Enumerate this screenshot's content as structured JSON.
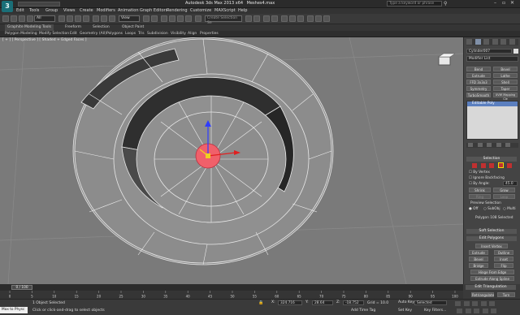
{
  "app": {
    "title": "Autodesk 3ds Max 2013 x64",
    "file": "Meshes4.max",
    "logo": "3"
  },
  "search": {
    "placeholder": "Type a keyword or phrase"
  },
  "menu": [
    "Edit",
    "Tools",
    "Group",
    "Views",
    "Create",
    "Modifiers",
    "Animation",
    "Graph Editors",
    "Rendering",
    "Customize",
    "MAXScript",
    "Help"
  ],
  "toolbar": {
    "filter": "All",
    "refcoord": "View",
    "selset": "Create Selection Se"
  },
  "ribbon": {
    "tabs": [
      "Graphite Modeling Tools",
      "Freeform",
      "Selection",
      "Object Paint"
    ],
    "row": [
      "Polygon Modeling",
      "Modify Selection",
      "Edit",
      "Geometry (All)",
      "Polygons",
      "Loops",
      "Tris",
      "Subdivision",
      "Visibility",
      "Align",
      "Properties"
    ]
  },
  "viewport": {
    "label": "[ + ] [ Perspective ] [ Shaded + Edged Faces ]"
  },
  "cmd": {
    "objname": "Cylinder007",
    "modlist": "Modifier List",
    "buttons": [
      "Bend",
      "Bevel",
      "Extrude",
      "Lathe",
      "FFD 3x3x3",
      "Shell",
      "Symmetry",
      "Taper",
      "TurboSmooth",
      "UVW Mapping Cle"
    ],
    "stack_item": "Editable Poly",
    "selection": {
      "title": "Selection",
      "by_vertex": "By Vertex",
      "ignore_backfacing": "Ignore Backfacing",
      "by_angle": "By Angle:",
      "angle": "45.0",
      "shrink": "Shrink",
      "grow": "Grow",
      "ring": "Ring",
      "loop": "Loop",
      "preview": "Preview Selection",
      "off": "Off",
      "subobj": "SubObj",
      "multi": "Multi",
      "status": "Polygon 108 Selected"
    },
    "soft_sel": "Soft Selection",
    "edit_poly": "Edit Polygons",
    "insert_vertex": "Insert Vertex",
    "ops": [
      "Extrude",
      "Outline",
      "Bevel",
      "Inset",
      "Bridge",
      "Flip"
    ],
    "hinge": "Hinge From Edge",
    "extrude_spline": "Extrude Along Spline",
    "edit_tri": "Edit Triangulation",
    "retri": "Retriangulate",
    "turn": "Turn"
  },
  "timeline": {
    "frame": "0 / 100",
    "ticks": [
      "0",
      "5",
      "10",
      "15",
      "20",
      "25",
      "30",
      "35",
      "40",
      "45",
      "50",
      "55",
      "60",
      "65",
      "70",
      "75",
      "80",
      "85",
      "90",
      "95",
      "100"
    ]
  },
  "status": {
    "maxscript": "Max to Physc",
    "selected": "1 Object Selected",
    "prompt": "Click or click-and-drag to select objects",
    "x": "324.716",
    "y": "28.64",
    "z": "-18.752",
    "grid": "Grid = 10.0",
    "autokey": "Auto Key",
    "setkey": "Set Key",
    "selected_dd": "Selected",
    "keyfilters": "Key Filters...",
    "addtimetag": "Add Time Tag"
  },
  "colors": {
    "viewport": "#7a7a7a",
    "selected": "#f0606a",
    "accent": "#1a6f78"
  }
}
